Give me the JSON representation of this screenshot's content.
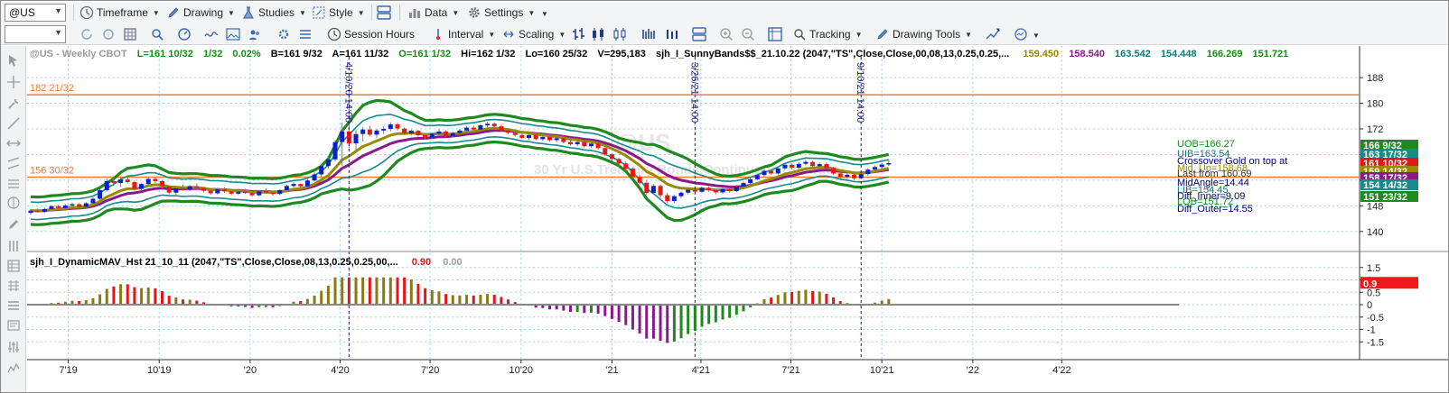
{
  "toolbar1": {
    "symbol": "@US",
    "items": [
      "Timeframe",
      "Drawing",
      "Studies",
      "Style",
      "Data",
      "Settings"
    ]
  },
  "toolbar2": {
    "combo": "",
    "items": [
      "Session Hours",
      "Interval",
      "Scaling",
      "Tracking",
      "Drawing Tools"
    ]
  },
  "header": {
    "symbol_info": "@US - Weekly  CBOT",
    "l": "L=161 10/32",
    "chg": "1/32",
    "pct": "0.02%",
    "b": "B=161 9/32",
    "a": "A=161 11/32",
    "o": "O=161 1/32",
    "hi": "Hi=162 1/32",
    "lo": "Lo=160 25/32",
    "v": "V=295,183",
    "study": "sjh_I_SunnyBands$$_21.10.22 (2047,\"TS\",Close,Close,00,08,13,0.25,0.25,...",
    "values": [
      {
        "text": "159.450",
        "color": "#9a8a00"
      },
      {
        "text": "158.540",
        "color": "#8a1a8a"
      },
      {
        "text": "163.542",
        "color": "#0a7a7a"
      },
      {
        "text": "154.448",
        "color": "#0a7a7a"
      },
      {
        "text": "166.269",
        "color": "#1a8a1a"
      },
      {
        "text": "151.721",
        "color": "#1a8a1a"
      }
    ]
  },
  "lower_header": {
    "study": "sjh_I_DynamicMAV_Hst 21_10_11 (2047,\"TS\",Close,Close,08,13,0.25,0.25,00,...",
    "v1": "0.90",
    "v2": "0.00"
  },
  "hlines": [
    {
      "label": "182 21/32",
      "value": 182.66,
      "color": "#f07a3a"
    },
    {
      "label": "156 30/32",
      "value": 156.94,
      "color": "#f07a3a"
    }
  ],
  "vlines": [
    {
      "label": "4/10/20 14:00",
      "date": "2020-04-10"
    },
    {
      "label": "3/26/21 14:00",
      "date": "2021-03-26"
    },
    {
      "label": "9/10/21 14:00",
      "date": "2021-09-10"
    }
  ],
  "price_axis": {
    "ticks": [
      "188",
      "180",
      "172",
      "164",
      "156",
      "148",
      "140"
    ]
  },
  "osc_axis": {
    "ticks": [
      "1.5",
      "1",
      "0.5",
      "0",
      "-0.5",
      "-1",
      "-1.5"
    ]
  },
  "time_axis": {
    "ticks": [
      "7'19",
      "10'19",
      "'20",
      "4'20",
      "7'20",
      "10'20",
      "'21",
      "4'21",
      "7'21",
      "10'21",
      "'22",
      "4'22"
    ]
  },
  "price_tags": [
    {
      "text": "166 9/32",
      "color": "#1e8a1e"
    },
    {
      "text": "163 17/32",
      "color": "#178a8a"
    },
    {
      "text": "161 10/32",
      "color": "#e21818"
    },
    {
      "text": "159 14/32",
      "color": "#9a8a00"
    },
    {
      "text": "158 17/32",
      "color": "#8a1a8a"
    },
    {
      "text": "154 14/32",
      "color": "#178a8a"
    },
    {
      "text": "151 23/32",
      "color": "#1e8a1e"
    }
  ],
  "osc_tag": {
    "text": "0.9",
    "color": "#f01818"
  },
  "right_labels": [
    {
      "text": "UOB=166.27",
      "color": "#1a8a1a"
    },
    {
      "text": "UIB=163.54",
      "color": "#0a7a7a"
    },
    {
      "text": "Crossover Gold on top at",
      "color": "#000080"
    },
    {
      "text": "Mid_Up=158.68",
      "color": "#9a8a00"
    },
    {
      "text": "Last from 160.69",
      "color": "#333333"
    },
    {
      "text": "MidAngle=14.44",
      "color": "#000080"
    },
    {
      "text": "LIB=154.45",
      "color": "#0a7a7a"
    },
    {
      "text": "Diff_Inner=9.09",
      "color": "#000080"
    },
    {
      "text": "LOB=151.72",
      "color": "#1a8a1a"
    },
    {
      "text": "Diff_Outer=14.55",
      "color": "#000080"
    }
  ],
  "watermark": {
    "symbol": "@US",
    "desc": "30 Yr U.S.Treasury Bonds Continuous Contract"
  },
  "colors": {
    "up": "#0a1fd0",
    "down": "#f01414",
    "neutral": "#7a7a7a",
    "outer": "#1e8a1e",
    "inner": "#178a8a",
    "mid_gold": "#9a8a00",
    "mid_purple": "#8a1a8a",
    "hist_up": "#8a7a10",
    "hist_down": "#e21818",
    "hist_purple": "#8a1a8a",
    "hist_green": "#1e8a1e"
  },
  "chart_data": {
    "type": "candlestick",
    "start": "2019-05-24",
    "ohlc": [
      [
        145.8,
        147.0,
        145.2,
        146.5
      ],
      [
        146.5,
        147.2,
        145.9,
        146.1
      ],
      [
        146.1,
        147.4,
        145.8,
        147.0
      ],
      [
        147.0,
        148.2,
        146.6,
        147.9
      ],
      [
        147.9,
        148.3,
        147.0,
        147.3
      ],
      [
        147.3,
        148.6,
        146.9,
        148.1
      ],
      [
        148.1,
        149.0,
        147.5,
        148.5
      ],
      [
        148.5,
        148.9,
        147.4,
        147.7
      ],
      [
        147.7,
        149.2,
        147.3,
        148.8
      ],
      [
        148.8,
        150.6,
        148.4,
        150.2
      ],
      [
        150.2,
        153.4,
        149.9,
        152.9
      ],
      [
        152.9,
        156.5,
        152.4,
        155.7
      ],
      [
        155.7,
        157.2,
        154.3,
        155.1
      ],
      [
        155.1,
        156.8,
        153.9,
        156.2
      ],
      [
        156.2,
        157.4,
        155.0,
        155.4
      ],
      [
        155.4,
        155.9,
        152.7,
        153.3
      ],
      [
        153.3,
        155.2,
        152.6,
        154.8
      ],
      [
        154.8,
        157.0,
        154.2,
        156.4
      ],
      [
        156.4,
        156.9,
        155.2,
        155.7
      ],
      [
        155.7,
        156.1,
        153.5,
        154.1
      ],
      [
        154.1,
        154.4,
        151.6,
        152.1
      ],
      [
        152.1,
        153.8,
        151.5,
        153.4
      ],
      [
        153.4,
        154.6,
        152.7,
        153.0
      ],
      [
        153.0,
        154.5,
        152.6,
        154.1
      ],
      [
        154.1,
        155.0,
        153.1,
        153.6
      ],
      [
        153.6,
        153.9,
        152.2,
        152.7
      ],
      [
        152.7,
        153.3,
        151.4,
        151.9
      ],
      [
        151.9,
        153.6,
        151.5,
        153.1
      ],
      [
        153.1,
        153.8,
        152.0,
        152.5
      ],
      [
        152.5,
        153.0,
        151.3,
        151.8
      ],
      [
        151.8,
        152.9,
        151.3,
        152.4
      ],
      [
        152.4,
        153.3,
        151.7,
        152.0
      ],
      [
        152.0,
        152.5,
        150.8,
        151.3
      ],
      [
        151.3,
        152.8,
        151.0,
        152.5
      ],
      [
        152.5,
        153.4,
        151.8,
        152.1
      ],
      [
        152.1,
        152.6,
        151.2,
        151.7
      ],
      [
        151.7,
        153.1,
        151.3,
        152.9
      ],
      [
        152.9,
        154.6,
        152.5,
        154.2
      ],
      [
        154.2,
        155.3,
        153.7,
        154.8
      ],
      [
        154.8,
        155.0,
        153.6,
        154.1
      ],
      [
        154.1,
        156.3,
        153.8,
        155.9
      ],
      [
        155.9,
        158.4,
        155.5,
        157.8
      ],
      [
        157.8,
        161.0,
        157.0,
        160.4
      ],
      [
        160.4,
        163.2,
        159.6,
        162.5
      ],
      [
        162.5,
        168.6,
        161.8,
        167.9
      ],
      [
        167.9,
        173.9,
        160.5,
        171.2
      ],
      [
        171.2,
        183.5,
        166.0,
        167.5
      ],
      [
        167.5,
        171.8,
        165.3,
        170.4
      ],
      [
        170.4,
        172.5,
        168.1,
        171.8
      ],
      [
        171.8,
        172.9,
        169.6,
        170.2
      ],
      [
        170.2,
        172.0,
        169.1,
        171.5
      ],
      [
        171.5,
        172.8,
        170.4,
        172.0
      ],
      [
        172.0,
        174.1,
        171.3,
        173.4
      ],
      [
        173.4,
        173.9,
        171.5,
        172.1
      ],
      [
        172.1,
        172.4,
        170.2,
        170.6
      ],
      [
        170.6,
        171.8,
        169.9,
        171.4
      ],
      [
        171.4,
        171.7,
        169.6,
        170.0
      ],
      [
        170.0,
        170.6,
        168.7,
        169.3
      ],
      [
        169.3,
        170.9,
        168.8,
        170.5
      ],
      [
        170.5,
        171.9,
        170.0,
        171.2
      ],
      [
        171.2,
        171.6,
        169.4,
        169.8
      ],
      [
        169.8,
        171.1,
        169.3,
        170.7
      ],
      [
        170.7,
        172.0,
        170.2,
        171.5
      ],
      [
        171.5,
        172.9,
        171.0,
        172.4
      ],
      [
        172.4,
        173.1,
        171.3,
        171.8
      ],
      [
        171.8,
        173.5,
        171.4,
        173.1
      ],
      [
        173.1,
        174.2,
        172.5,
        173.6
      ],
      [
        173.6,
        174.0,
        172.3,
        172.8
      ],
      [
        172.8,
        173.3,
        171.0,
        171.5
      ],
      [
        171.5,
        172.1,
        170.3,
        170.8
      ],
      [
        170.8,
        171.4,
        169.6,
        170.1
      ],
      [
        170.1,
        170.7,
        168.8,
        169.2
      ],
      [
        169.2,
        170.6,
        168.7,
        170.1
      ],
      [
        170.1,
        170.5,
        168.4,
        168.8
      ],
      [
        168.8,
        169.9,
        168.2,
        169.5
      ],
      [
        169.5,
        170.0,
        168.0,
        168.5
      ],
      [
        168.5,
        169.6,
        167.9,
        169.1
      ],
      [
        169.1,
        169.4,
        167.5,
        167.9
      ],
      [
        167.9,
        168.6,
        166.8,
        167.2
      ],
      [
        167.2,
        168.3,
        166.6,
        167.9
      ],
      [
        167.9,
        168.2,
        166.2,
        166.6
      ],
      [
        166.6,
        167.9,
        166.0,
        167.4
      ],
      [
        167.4,
        167.7,
        165.6,
        166.0
      ],
      [
        166.0,
        166.3,
        163.6,
        164.1
      ],
      [
        164.1,
        164.5,
        161.9,
        162.6
      ],
      [
        162.6,
        163.0,
        160.6,
        161.2
      ],
      [
        161.2,
        161.8,
        158.9,
        159.6
      ],
      [
        159.6,
        160.0,
        156.4,
        157.0
      ],
      [
        157.0,
        157.8,
        154.5,
        155.2
      ],
      [
        155.2,
        155.9,
        151.4,
        152.0
      ],
      [
        152.0,
        154.8,
        151.5,
        154.2
      ],
      [
        154.2,
        154.6,
        150.6,
        151.3
      ],
      [
        151.3,
        152.1,
        148.8,
        149.5
      ],
      [
        149.5,
        151.5,
        148.9,
        151.0
      ],
      [
        151.0,
        152.5,
        150.4,
        152.1
      ],
      [
        152.1,
        153.5,
        151.6,
        153.0
      ],
      [
        153.0,
        153.4,
        151.9,
        152.4
      ],
      [
        152.4,
        154.0,
        152.0,
        153.6
      ],
      [
        153.6,
        154.1,
        152.4,
        152.9
      ],
      [
        152.9,
        153.3,
        151.6,
        152.2
      ],
      [
        152.2,
        153.6,
        151.8,
        153.2
      ],
      [
        153.2,
        153.8,
        152.1,
        152.6
      ],
      [
        152.6,
        154.5,
        152.2,
        154.0
      ],
      [
        154.0,
        155.6,
        153.5,
        155.1
      ],
      [
        155.1,
        156.8,
        154.6,
        156.3
      ],
      [
        156.3,
        158.1,
        155.9,
        157.6
      ],
      [
        157.6,
        159.4,
        157.1,
        158.9
      ],
      [
        158.9,
        159.5,
        157.7,
        158.1
      ],
      [
        158.1,
        160.2,
        157.7,
        159.7
      ],
      [
        159.7,
        161.3,
        159.2,
        160.8
      ],
      [
        160.8,
        161.2,
        159.4,
        159.9
      ],
      [
        159.9,
        161.6,
        159.5,
        161.1
      ],
      [
        161.1,
        162.3,
        160.6,
        161.7
      ],
      [
        161.7,
        162.1,
        159.9,
        160.4
      ],
      [
        160.4,
        161.5,
        159.8,
        161.0
      ],
      [
        161.0,
        161.5,
        159.4,
        159.8
      ],
      [
        159.8,
        160.2,
        157.6,
        158.1
      ],
      [
        158.1,
        158.5,
        156.5,
        157.0
      ],
      [
        157.0,
        158.2,
        156.4,
        157.7
      ],
      [
        157.7,
        158.1,
        156.1,
        156.6
      ],
      [
        156.6,
        158.3,
        156.2,
        157.9
      ],
      [
        157.9,
        159.8,
        157.4,
        159.3
      ],
      [
        159.3,
        160.6,
        158.7,
        160.1
      ],
      [
        160.1,
        161.4,
        159.6,
        160.9
      ],
      [
        160.9,
        162.5,
        160.4,
        161.3
      ]
    ]
  }
}
